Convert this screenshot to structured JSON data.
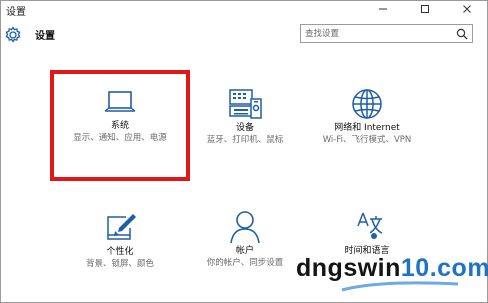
{
  "window": {
    "title": "设置",
    "controls": [
      "minimize-icon",
      "maximize-icon",
      "close-icon"
    ]
  },
  "header": {
    "title": "设置",
    "search_placeholder": "查找设置"
  },
  "tiles": [
    {
      "title": "系统",
      "desc": "显示、通知、应用、电源",
      "icon": "laptop-icon",
      "highlighted": true
    },
    {
      "title": "设备",
      "desc": "蓝牙、打印机、鼠标",
      "icon": "devices-icon"
    },
    {
      "title": "网络和 Internet",
      "desc": "Wi-Fi、飞行模式、VPN",
      "icon": "globe-icon"
    },
    {
      "title": "个性化",
      "desc": "背景、锁屏、颜色",
      "icon": "personalization-icon"
    },
    {
      "title": "帐户",
      "desc": "你的帐户、同步设置",
      "icon": "person-icon"
    },
    {
      "title": "时间和语言",
      "desc": "",
      "icon": "time-language-icon"
    }
  ],
  "watermark": {
    "text_main": "dngswin",
    "text_accent": "10.com"
  },
  "colors": {
    "accent": "#1f5fa6",
    "highlight_border": "#e01818"
  }
}
